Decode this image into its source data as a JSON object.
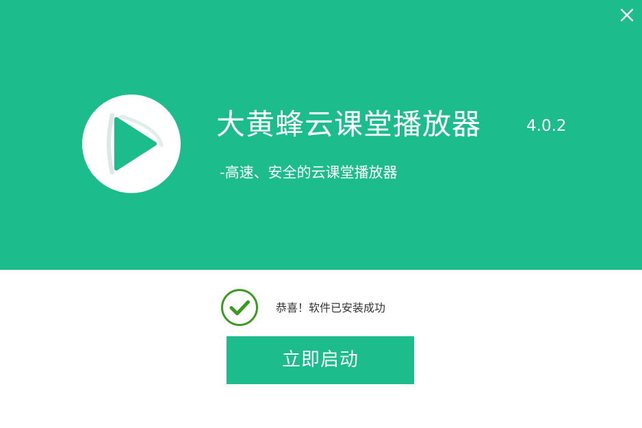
{
  "window": {
    "close_icon": "close-icon"
  },
  "header": {
    "logo_icon": "play-logo-icon",
    "title": "大黄蜂云课堂播放器",
    "version": "4.0.2",
    "subtitle": "-高速、安全的云课堂播放器"
  },
  "status": {
    "icon": "check-circle-icon",
    "message": "恭喜！软件已安装成功"
  },
  "actions": {
    "launch_label": "立即启动"
  },
  "colors": {
    "brand": "#1cbc8c",
    "success": "#3a9a1e",
    "text": "#333333",
    "background": "#ffffff"
  }
}
